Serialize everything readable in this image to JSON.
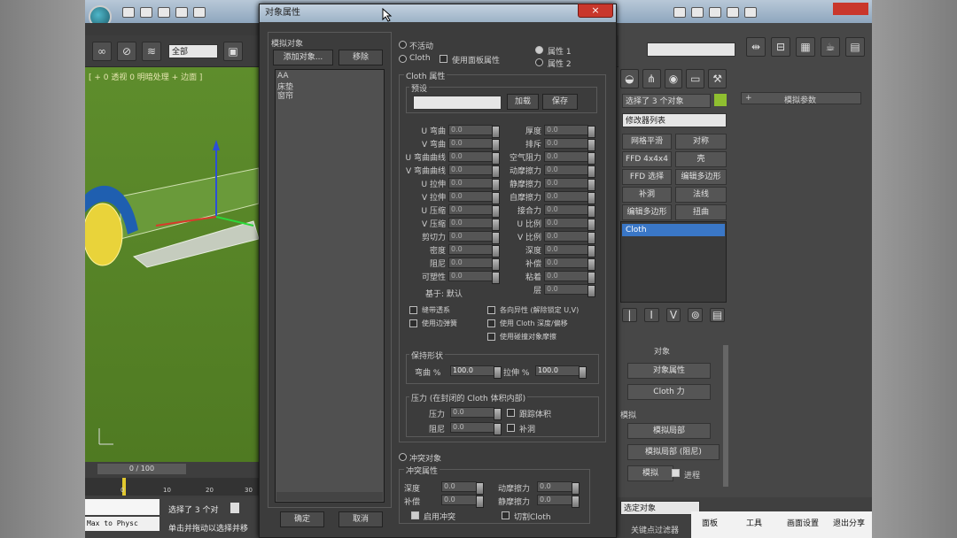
{
  "app": {
    "viewport_label": "[ + 0 透视 0 明暗处理 + 边面 ]",
    "selection_filter": "全部",
    "timeline_counter": "0 / 100",
    "timeline_ticks": [
      "0",
      "10",
      "20",
      "30"
    ],
    "status_selected": "选择了 3 个对",
    "status_hint": "单击并拖动以选择并移",
    "maxscript_text": "Max to Physc"
  },
  "dialog": {
    "title": "对象属性",
    "close_symbol": "×",
    "sim_objects_label": "模拟对象",
    "add_objects_button": "添加对象...",
    "remove_button": "移除",
    "objects": [
      "AA",
      "床垫",
      "窗帘"
    ],
    "ok_button": "确定",
    "cancel_button": "取消",
    "radio_inactive": "不活动",
    "radio_cloth": "Cloth",
    "use_panel_props": "使用面板属性",
    "property1": "属性 1",
    "property2": "属性 2",
    "cloth_props_title": "Cloth 属性",
    "preset_title": "预设",
    "load_button": "加载",
    "save_button": "保存",
    "left_params": [
      "U 弯曲",
      "V 弯曲",
      "U 弯曲曲线",
      "V 弯曲曲线",
      "U 拉伸",
      "V 拉伸",
      "U 压缩",
      "V 压缩",
      "剪切力",
      "密度",
      "阻尼",
      "可塑性"
    ],
    "right_params": [
      "厚度",
      "排斥",
      "空气阻力",
      "动摩擦力",
      "静摩擦力",
      "自摩擦力",
      "接合力",
      "U 比例",
      "V 比例",
      "深度",
      "补偿",
      "粘着",
      "层"
    ],
    "based_on": "基于: 默认",
    "chk_use_edge_springs": "缝带透系",
    "chk_use_edge_springs2": "使用边弹簧",
    "chk_anisotropic": "各向异性 (解除锁定 U,V)",
    "chk_use_cloth_depth": "使用 Cloth 深度/偏移",
    "chk_use_solid_friction": "使用碰撞对象摩擦",
    "shape_title": "保持形状",
    "bend_pct": "弯曲 %",
    "bend_value": "100.0",
    "stretch_pct": "拉伸 %",
    "stretch_value": "100.0",
    "pressure_title": "压力 (在封闭的 Cloth 体积内部)",
    "pressure_label": "压力",
    "damping_label": "阻尼",
    "track_volume": "跟踪体积",
    "cap_holes": "补洞",
    "collision_obj_radio": "冲突对象",
    "collision_props_title": "冲突属性",
    "coll_depth": "深度",
    "coll_offset": "补偿",
    "coll_dyn_friction": "动摩擦力",
    "coll_static_friction": "静摩擦力",
    "chk_enable_coll": "启用冲突",
    "chk_cut_cloth": "切割Cloth"
  },
  "panel": {
    "object_name": "选择了 3 个对象",
    "modifier_list": "修改器列表",
    "buttons": [
      "网格平滑",
      "对称",
      "FFD 4x4x4",
      "壳",
      "FFD 选择",
      "编辑多边形",
      "补洞",
      "法线",
      "编辑多边形",
      "扭曲"
    ],
    "stack_item": "Cloth",
    "rollout_header": "模拟参数",
    "rollout_object": "对象",
    "object_props_button": "对象属性",
    "cloth_force_button": "Cloth 力",
    "sim_section": "模拟",
    "sim_local_button": "模拟局部",
    "sim_local_damped_button": "模拟局部 (阻尼)",
    "simulate_button": "模拟",
    "progress_chk": "进程",
    "select_object_dropdown": "选定对象"
  },
  "taskbar": {
    "panel": "面板",
    "tools": "工具",
    "screen_settings": "画面设置",
    "exit_share": "退出分享",
    "key_filter": "关键点过滤器"
  },
  "values": {
    "spinner_default": "0.0"
  }
}
